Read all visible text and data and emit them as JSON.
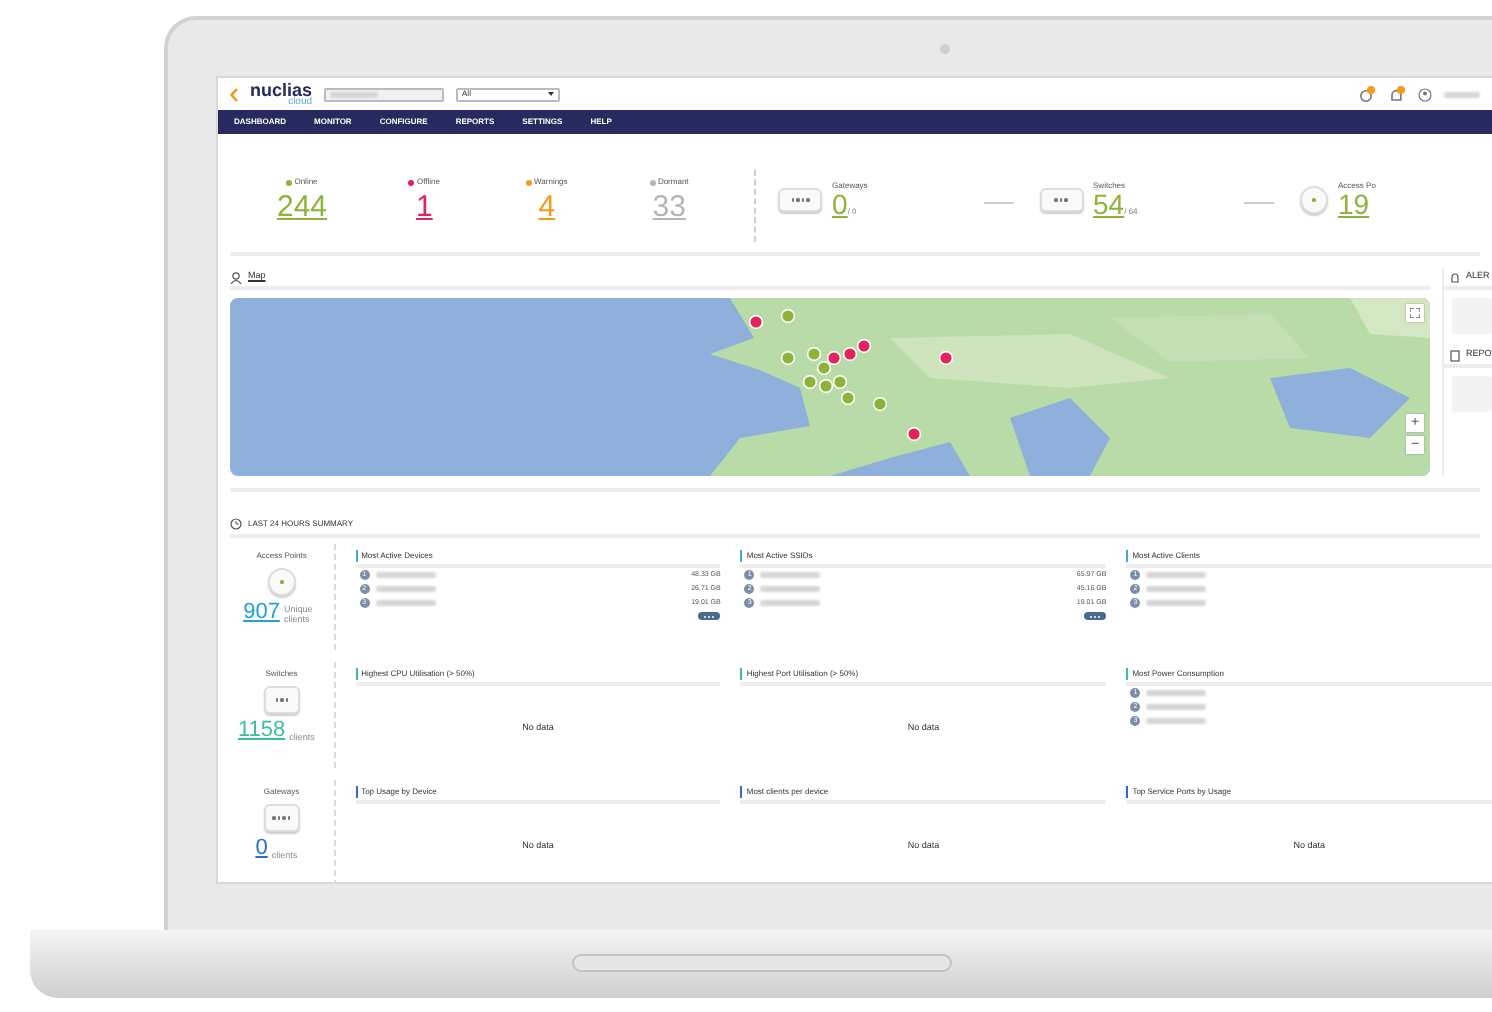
{
  "header": {
    "logo": "nuclias",
    "logo_sub": "cloud",
    "site_select": {
      "value": "All"
    }
  },
  "nav": [
    "DASHBOARD",
    "MONITOR",
    "CONFIGURE",
    "REPORTS",
    "SETTINGS",
    "HELP"
  ],
  "status": [
    {
      "label": "Online",
      "value": "244",
      "color": "#8db33a"
    },
    {
      "label": "Offline",
      "value": "1",
      "color": "#e0245e"
    },
    {
      "label": "Warnings",
      "value": "4",
      "color": "#f39a1e"
    },
    {
      "label": "Dormant",
      "value": "33",
      "color": "#b5b5b5"
    }
  ],
  "devices": [
    {
      "kind": "gateway",
      "label": "Gateways",
      "value": "0",
      "total": "/ 0"
    },
    {
      "kind": "switch",
      "label": "Switches",
      "value": "54",
      "total": "/ 64"
    },
    {
      "kind": "ap",
      "label": "Access Po",
      "value": "19"
    }
  ],
  "map": {
    "title": "Map",
    "kind": "picture",
    "zoom_in": "+",
    "zoom_out": "−"
  },
  "side": [
    {
      "kind": "alerts",
      "title": "ALER"
    },
    {
      "kind": "reports",
      "title": "REPO"
    }
  ],
  "summary": {
    "title": "LAST 24 HOURS SUMMARY",
    "rows": [
      {
        "kind": "ap",
        "label": "Access Points",
        "count": "907",
        "count_note": "Unique clients",
        "color": "#1fa3d9",
        "panels": [
          {
            "title": "Most Active Devices",
            "color": "#3aa9d6",
            "more": true,
            "entries": [
              {
                "rank": "1",
                "value": "48.33 GB"
              },
              {
                "rank": "2",
                "value": "26.71 GB"
              },
              {
                "rank": "3",
                "value": "19.01 GB"
              }
            ]
          },
          {
            "title": "Most Active SSIDs",
            "color": "#3aa9d6",
            "more": true,
            "entries": [
              {
                "rank": "1",
                "value": "65.97 GB"
              },
              {
                "rank": "2",
                "value": "45.16 GB"
              },
              {
                "rank": "3",
                "value": "19.01 GB"
              }
            ]
          },
          {
            "title": "Most Active Clients",
            "color": "#3aa9d6",
            "more": false,
            "entries": [
              {
                "rank": "1"
              },
              {
                "rank": "2"
              },
              {
                "rank": "3"
              }
            ]
          }
        ]
      },
      {
        "kind": "switch",
        "label": "Switches",
        "count": "1158",
        "count_note": "clients",
        "color": "#3dbf9d",
        "panels": [
          {
            "title": "Highest CPU Utilisation (> 50%)",
            "color": "#3dbf9d",
            "empty": "No data"
          },
          {
            "title": "Highest Port Utilisation (> 50%)",
            "color": "#3dbf9d",
            "empty": "No data"
          },
          {
            "title": "Most Power Consumption",
            "color": "#3dbf9d",
            "more": false,
            "entries": [
              {
                "rank": "1"
              },
              {
                "rank": "2"
              },
              {
                "rank": "3"
              }
            ]
          }
        ]
      },
      {
        "kind": "gateway",
        "label": "Gateways",
        "count": "0",
        "count_note": "clients",
        "color": "#2a6fd0",
        "panels": [
          {
            "title": "Top Usage by Device",
            "color": "#2a6fd0",
            "empty": "No data"
          },
          {
            "title": "Most clients per device",
            "color": "#2a6fd0",
            "empty": "No data"
          },
          {
            "title": "Top Service Ports by Usage",
            "color": "#2a6fd0",
            "empty": "No data"
          }
        ]
      }
    ]
  }
}
